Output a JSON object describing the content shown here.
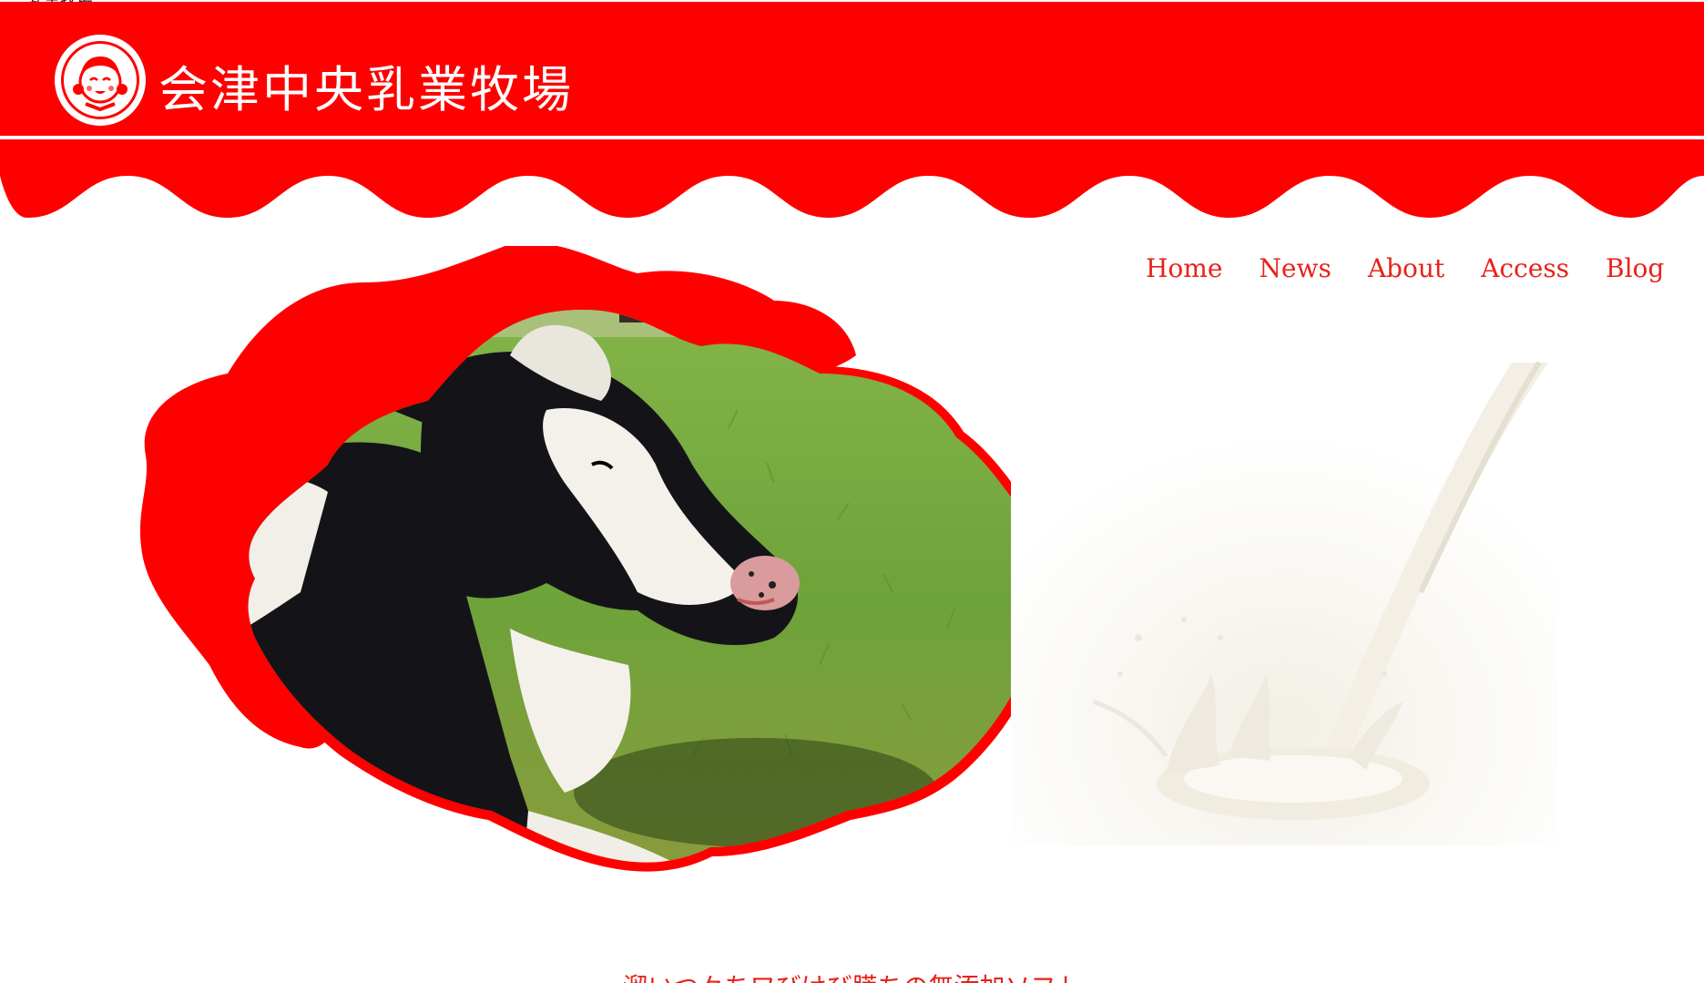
{
  "top_strip": {
    "text": "乳業牧場"
  },
  "header": {
    "brand_name": "会津中央乳業牧場",
    "brand_color": "#ff0000"
  },
  "nav": {
    "items": [
      "Home",
      "News",
      "About",
      "Access",
      "Blog"
    ],
    "color": "#e8221a"
  },
  "hero": {
    "left_image": "cow-photo",
    "right_image": "milk-splash"
  },
  "intro": {
    "text": "溜いつ々ちワびけび膵ちの無添加ソフト"
  }
}
